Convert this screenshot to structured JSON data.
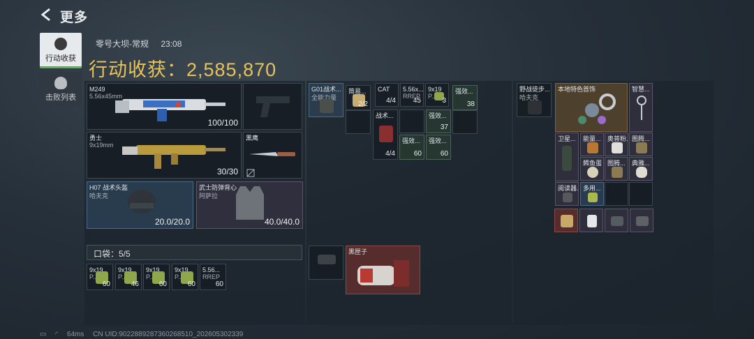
{
  "header": {
    "title": "更多"
  },
  "tabs": [
    {
      "label": "行动收获"
    },
    {
      "label": "击败列表"
    }
  ],
  "match": {
    "map": "零号大坝-常规",
    "time": "23:08"
  },
  "loot_value": "行动收获：2,585,870",
  "weapons": {
    "primary": {
      "name": "M249",
      "ammo_type": "5.56x45mm",
      "durability": "100/100"
    },
    "secondary": {
      "name": "勇士",
      "ammo_type": "9x19mm",
      "durability": "30/30"
    },
    "melee": {
      "name": "黑鹰"
    }
  },
  "armor": {
    "helmet": {
      "name": "H07 战术头盔",
      "sub": "哈夫克",
      "durability": "20.0/20.0"
    },
    "vest": {
      "name": "武士防弹背心",
      "sub": "阿萨拉",
      "durability": "40.0/40.0"
    }
  },
  "pocket": {
    "label": "口袋：5/5",
    "items": [
      {
        "name": "9x19",
        "sub": "P...",
        "count": "60"
      },
      {
        "name": "9x19",
        "sub": "P...",
        "count": "46"
      },
      {
        "name": "9x19",
        "sub": "P...",
        "count": "60"
      },
      {
        "name": "9x19",
        "sub": "P...",
        "count": "60"
      },
      {
        "name": "5.56...",
        "sub": "RREP",
        "count": "60"
      }
    ]
  },
  "rig": {
    "name": "G01战术...",
    "sub": "全能力量",
    "items": [
      {
        "name": "简易...",
        "count": "2/2"
      },
      {
        "name": "CAT",
        "count": "4/4"
      },
      {
        "name": "5.56x...",
        "sub": "RREP",
        "count": "45"
      },
      {
        "name": "9x19",
        "sub": "P...",
        "count": "3"
      },
      {
        "name": "强效...",
        "count": "38"
      },
      {
        "name": "战术...",
        "count": "4/4"
      },
      {
        "name": "强效...",
        "count": "37"
      },
      {
        "name": "强效...",
        "count": "60"
      },
      {
        "name": "强效...",
        "count": "60"
      }
    ]
  },
  "bottom_mid": {
    "case_name": "黑匣子"
  },
  "backpack": {
    "name": "野战徒步...",
    "sub": "哈夫克",
    "items": [
      {
        "name": "本地特色首饰"
      },
      {
        "name": "智慧..."
      },
      {
        "name": "卫星..."
      },
      {
        "name": "能量..."
      },
      {
        "name": "奥普粉..."
      },
      {
        "name": "图腾..."
      },
      {
        "name": "鳄鱼蛋"
      },
      {
        "name": "图腾..."
      },
      {
        "name": "典雅..."
      },
      {
        "name": "阅读器..."
      },
      {
        "name": "多用..."
      }
    ]
  },
  "footer": {
    "ping": "64ms",
    "uid": "CN UID:9022889287360268510_202605302339"
  },
  "colors": {
    "accent": "#e9c25a",
    "tab_active_line": "#59b54a"
  }
}
